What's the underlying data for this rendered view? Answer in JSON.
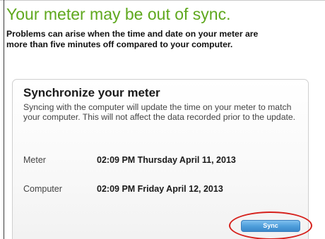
{
  "heading": "Your meter may be out of sync.",
  "intro": {
    "line1": "Problems can arise when the time and date on your meter are",
    "line2": "more than five minutes off compared to your computer."
  },
  "card": {
    "title": "Synchronize your meter",
    "description": "Syncing with the computer will update the time on your meter to match your computer.  This will not affect the data recorded prior to the update.",
    "meter_label": "Meter",
    "meter_value": "02:09 PM Thursday April 11, 2013",
    "computer_label": "Computer",
    "computer_value": "02:09 PM Friday April 12, 2013",
    "sync_button": "Sync"
  },
  "colors": {
    "heading": "#5fa81e",
    "button": "#4f9fdc",
    "highlight": "#d6201b"
  }
}
